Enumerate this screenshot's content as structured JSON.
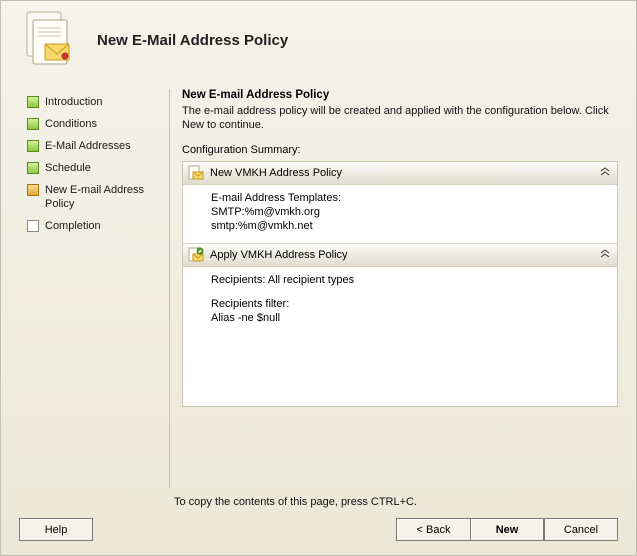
{
  "header": {
    "title": "New E-Mail Address Policy"
  },
  "sidebar": {
    "items": [
      {
        "label": "Introduction",
        "state": "done"
      },
      {
        "label": "Conditions",
        "state": "done"
      },
      {
        "label": "E-Mail Addresses",
        "state": "done"
      },
      {
        "label": "Schedule",
        "state": "done"
      },
      {
        "label": "New E-mail Address Policy",
        "state": "current"
      },
      {
        "label": "Completion",
        "state": "pending"
      }
    ]
  },
  "content": {
    "title": "New E-mail Address Policy",
    "description": "The e-mail address policy will be created and applied with the configuration below. Click New to continue.",
    "summary_label": "Configuration Summary:",
    "groups": [
      {
        "title": "New VMKH Address Policy",
        "lines": [
          "E-mail Address Templates:",
          "SMTP:%m@vmkh.org",
          "smtp:%m@vmkh.net"
        ]
      },
      {
        "title": "Apply VMKH Address Policy",
        "blocks": [
          [
            "Recipients: All recipient types"
          ],
          [
            "Recipients filter:",
            "Alias -ne $null"
          ]
        ]
      }
    ]
  },
  "footer": {
    "copy_hint": "To copy the contents of this page, press CTRL+C.",
    "help": "Help",
    "back": "< Back",
    "new": "New",
    "cancel": "Cancel"
  }
}
